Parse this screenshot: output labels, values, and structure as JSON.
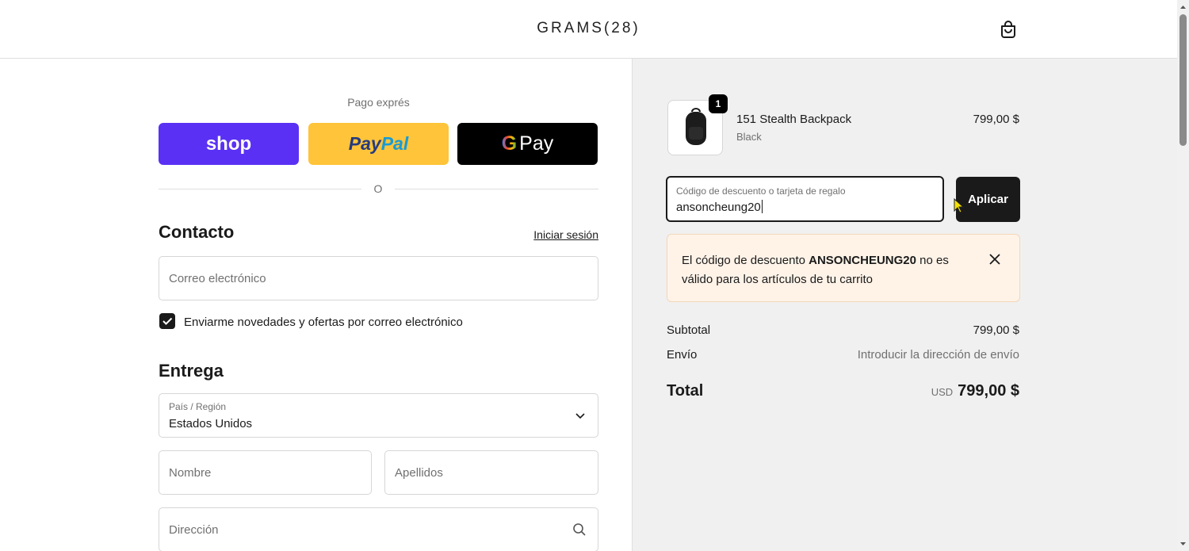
{
  "header": {
    "logo": "GRAMS(28)",
    "cart_icon": "shopping-bag-icon"
  },
  "express": {
    "title": "Pago exprés",
    "shop_label": "shop",
    "paypal_part1": "Pay",
    "paypal_part2": "Pal",
    "gpay_g": "G",
    "gpay_label": "Pay",
    "divider": "O"
  },
  "contact": {
    "title": "Contacto",
    "login_link": "Iniciar sesión",
    "email_placeholder": "Correo electrónico",
    "newsletter_label": "Enviarme novedades y ofertas por correo electrónico",
    "newsletter_checked": true
  },
  "delivery": {
    "title": "Entrega",
    "country_label": "País / Región",
    "country_value": "Estados Unidos",
    "first_name_placeholder": "Nombre",
    "last_name_placeholder": "Apellidos",
    "address_placeholder": "Dirección"
  },
  "summary": {
    "item": {
      "name": "151 Stealth Backpack",
      "variant": "Black",
      "price": "799,00 $",
      "quantity": "1"
    },
    "discount": {
      "label": "Código de descuento o tarjeta de regalo",
      "value": "ansoncheung20",
      "apply_label": "Aplicar"
    },
    "error": {
      "prefix": "El código de descuento ",
      "code": "ANSONCHEUNG20",
      "suffix": " no es válido para los artículos de tu carrito"
    },
    "subtotal_label": "Subtotal",
    "subtotal_value": "799,00 $",
    "shipping_label": "Envío",
    "shipping_value": "Introducir la dirección de envío",
    "total_label": "Total",
    "total_currency": "USD",
    "total_value": "799,00 $"
  },
  "colors": {
    "shop": "#5a31f4",
    "paypal": "#ffc439",
    "gpay": "#000000",
    "error_bg": "#fff3e8",
    "summary_bg": "#f0f0f0"
  }
}
